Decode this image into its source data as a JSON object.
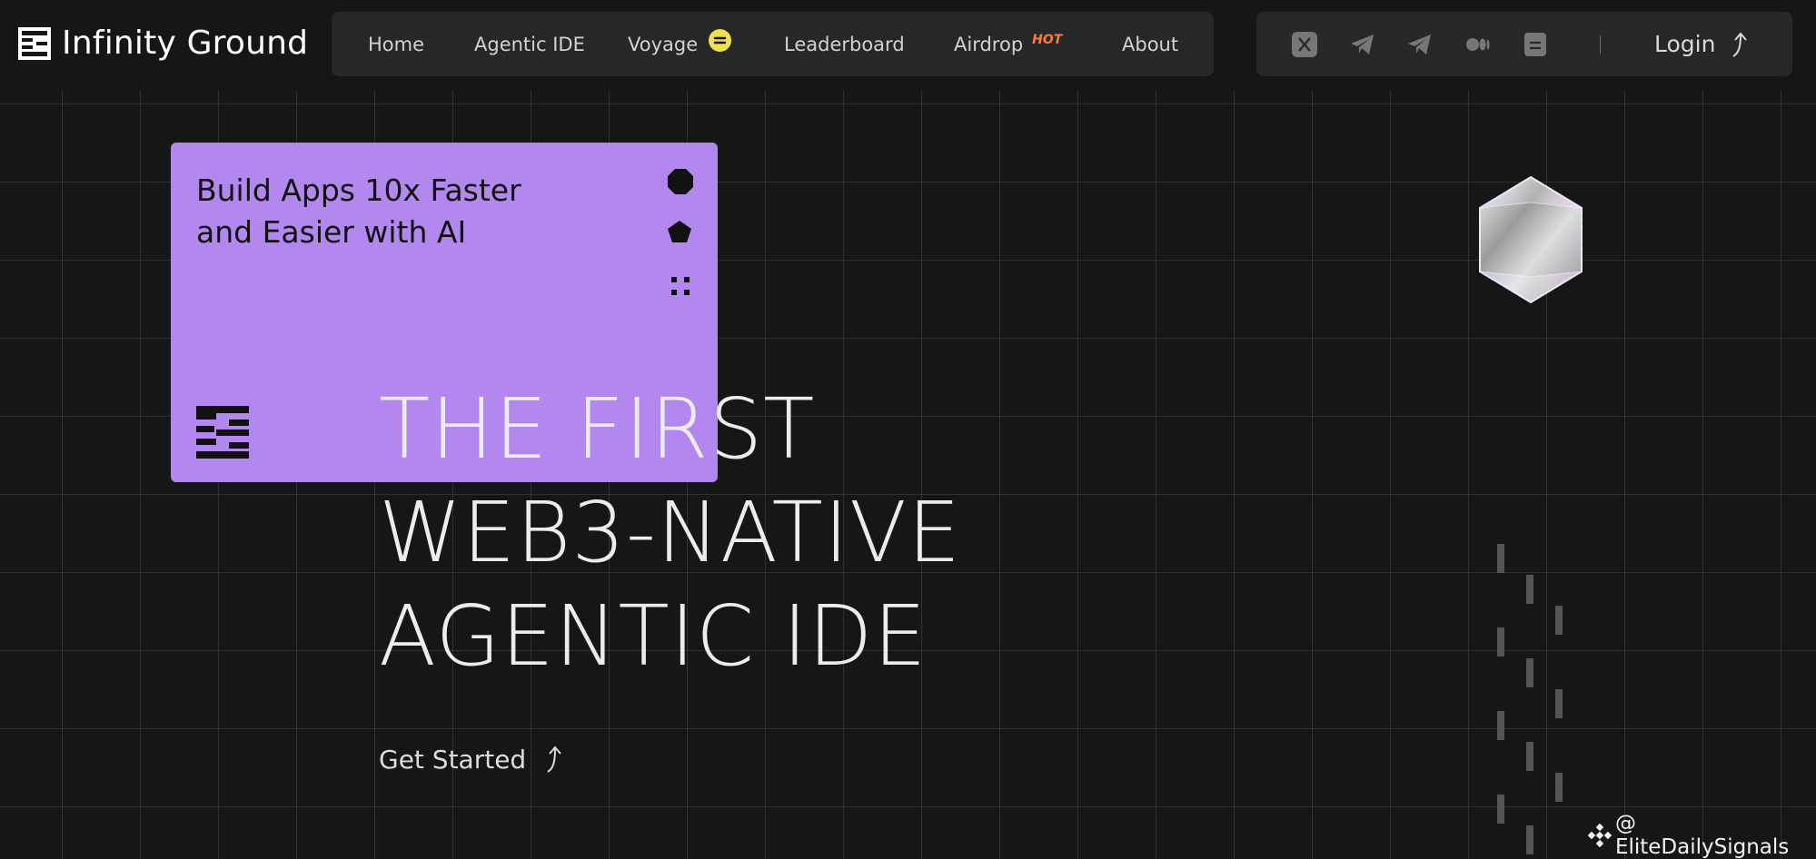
{
  "brand": {
    "name": "Infinity Ground",
    "logo_icon": "infinity-ground-logo-icon"
  },
  "nav": {
    "items": [
      {
        "label": "Home"
      },
      {
        "label": "Agentic IDE"
      },
      {
        "label": "Voyage",
        "badge_icon": "voyage-token-icon",
        "badge_color": "#efe14d"
      },
      {
        "label": "Leaderboard"
      },
      {
        "label": "Airdrop",
        "badge": "HOT"
      },
      {
        "label": "About"
      }
    ]
  },
  "social": {
    "icons": [
      "x-icon",
      "telegram-icon",
      "telegram-icon",
      "medium-icon",
      "docs-icon"
    ],
    "login_label": "Login",
    "login_icon": "arrow-up-curve-icon"
  },
  "card": {
    "title": "Build Apps 10x Faster and Easier with AI",
    "shapes": [
      "octagon-icon",
      "pentagon-icon",
      "four-dots-icon"
    ],
    "background": "#b288ee"
  },
  "hero": {
    "lines": [
      "THE FIRST",
      "WEB3-NATIVE",
      "AGENTIC IDE"
    ],
    "cta_label": "Get Started",
    "cta_icon": "arrow-up-curve-icon"
  },
  "watermark": {
    "text": "@ EliteDailySignals",
    "icon": "binance-icon"
  },
  "colors": {
    "background": "#151716",
    "panel": "#262828",
    "accent_purple": "#b288ee",
    "voyage_yellow": "#efe14d"
  }
}
